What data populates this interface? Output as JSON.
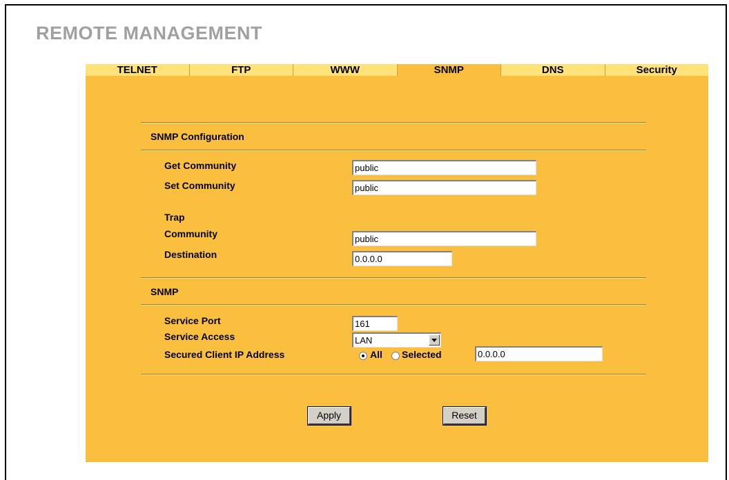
{
  "page": {
    "title": "REMOTE MANAGEMENT"
  },
  "tabs": [
    {
      "label": "TELNET",
      "active": false
    },
    {
      "label": "FTP",
      "active": false
    },
    {
      "label": "WWW",
      "active": false
    },
    {
      "label": "SNMP",
      "active": true
    },
    {
      "label": "DNS",
      "active": false
    },
    {
      "label": "Security",
      "active": false
    }
  ],
  "snmp_config": {
    "section_title": "SNMP Configuration",
    "get_community_label": "Get Community",
    "get_community_value": "public",
    "set_community_label": "Set Community",
    "set_community_value": "public",
    "trap_label": "Trap",
    "trap_community_label": "Community",
    "trap_community_value": "public",
    "trap_destination_label": "Destination",
    "trap_destination_value": "0.0.0.0"
  },
  "snmp": {
    "section_title": "SNMP",
    "service_port_label": "Service Port",
    "service_port_value": "161",
    "service_access_label": "Service Access",
    "service_access_value": "LAN",
    "secured_client_label": "Secured Client IP Address",
    "radio_all_label": "All",
    "radio_selected_label": "Selected",
    "radio_all_checked": true,
    "secured_ip_value": "0.0.0.0"
  },
  "buttons": {
    "apply_label": "Apply",
    "reset_label": "Reset"
  },
  "colors": {
    "panel": "#fbbf3f",
    "tab_inactive": "#ffe27a",
    "title_gray": "#a0a0a0"
  }
}
